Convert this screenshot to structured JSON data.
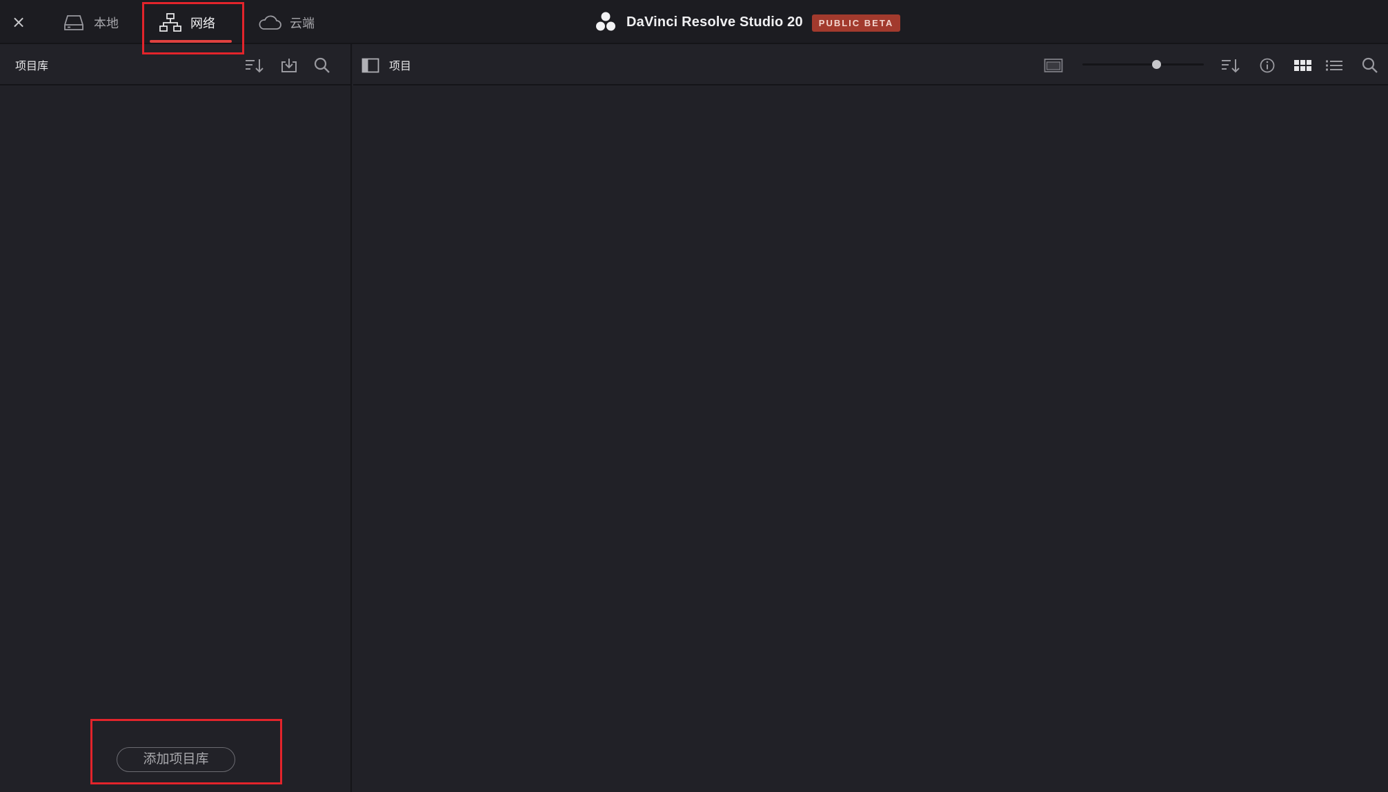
{
  "window": {
    "close_glyph": "×",
    "app_title": "DaVinci Resolve Studio 20",
    "beta_badge": "PUBLIC BETA",
    "accent_color": "#e0413f",
    "badge_color": "#a23a2d"
  },
  "tabs": [
    {
      "label": "本地",
      "icon": "hard-drive-icon",
      "active": false
    },
    {
      "label": "网络",
      "icon": "network-icon",
      "active": true
    },
    {
      "label": "云端",
      "icon": "cloud-icon",
      "active": false
    }
  ],
  "left_panel": {
    "title": "项目库",
    "icons": [
      "sort-icon",
      "import-icon",
      "search-icon"
    ],
    "add_button": "添加项目库"
  },
  "right_panel": {
    "title": "项目",
    "icons": [
      "sidebar-toggle-icon",
      "thumbnail-icon",
      "sort-icon",
      "info-icon",
      "grid-view-icon",
      "list-view-icon",
      "search-icon"
    ],
    "thumbnail_size": 0.62
  }
}
